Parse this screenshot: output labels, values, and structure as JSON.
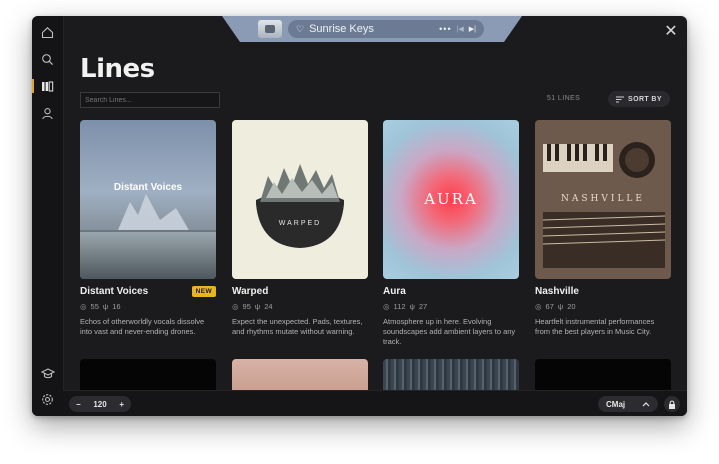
{
  "player": {
    "track_name": "Sunrise Keys"
  },
  "page": {
    "title": "Lines",
    "search_placeholder": "Search Lines...",
    "count": "51 LINES",
    "sort_label": "SORT BY"
  },
  "cards": [
    {
      "title": "Distant Voices",
      "badge": "NEW",
      "plays": "55",
      "likes": "16",
      "desc": "Echos of otherworldly vocals dissolve into vast and never-ending drones.",
      "art_text": "Distant Voices"
    },
    {
      "title": "Warped",
      "badge": "",
      "plays": "95",
      "likes": "24",
      "desc": "Expect the unexpected. Pads, textures, and rhythms mutate without warning.",
      "art_text": "WARPED"
    },
    {
      "title": "Aura",
      "badge": "",
      "plays": "112",
      "likes": "27",
      "desc": "Atmosphere up in here. Evolving soundscapes add ambient layers to any track.",
      "art_text": "AURA"
    },
    {
      "title": "Nashville",
      "badge": "",
      "plays": "67",
      "likes": "20",
      "desc": "Heartfelt instrumental performances from the best players in Music City.",
      "art_text": "NASHVILLE"
    }
  ],
  "bottom": {
    "bpm": "120",
    "key": "CMaj"
  },
  "colors": {
    "accent": "#e0a527",
    "badge": "#e7b424",
    "background": "#1b1b1d"
  }
}
